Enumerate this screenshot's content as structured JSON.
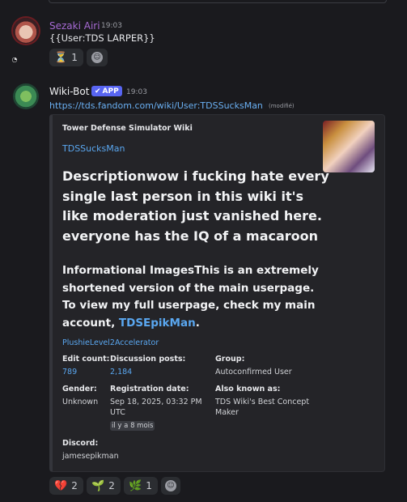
{
  "message1": {
    "username": "Sezaki Airi",
    "username_color": "#a66ad3",
    "time": "19:03",
    "text": "{{User:TDS LARPER}}",
    "reactions": [
      {
        "icon": "hourglass-icon",
        "emoji": "⏳",
        "count": "1"
      }
    ]
  },
  "message2": {
    "username": "Wiki-Bot",
    "badge": "APP",
    "time": "19:03",
    "link": "https://tds.fandom.com/wiki/User:TDSSucksMan",
    "modified": "(modifié)",
    "embed": {
      "provider": "Tower Defense Simulator Wiki",
      "title": "TDSSucksMan",
      "description": "Descriptionwow i fucking hate every single last person in this wiki it's like moderation just vanished here. everyone has the IQ of a macaroon",
      "info_text": "Informational ImagesThis is an extremely shortened version of the main userpage. To view my full userpage, check my main account,",
      "info_link": "TDSEpikMan",
      "info_end": ".",
      "plushie": "PlushieLevel2Accelerator",
      "fields": {
        "edit_count": {
          "name": "Edit count:",
          "value": "789"
        },
        "discussion_posts": {
          "name": "Discussion posts:",
          "value": "2,184"
        },
        "group": {
          "name": "Group:",
          "value": "Autoconfirmed User"
        },
        "gender": {
          "name": "Gender:",
          "value": "Unknown"
        },
        "registration": {
          "name": "Registration date:",
          "value": "Sep 18, 2025, 03:32 PM UTC",
          "relative": "il y a 8 mois"
        },
        "also_known": {
          "name": "Also known as:",
          "value": "TDS Wiki's Best Concept Maker"
        },
        "discord": {
          "name": "Discord:",
          "value": "jamesepikman"
        }
      }
    },
    "reactions": [
      {
        "icon": "broken-heart-icon",
        "emoji": "💔",
        "count": "2"
      },
      {
        "icon": "sprout-icon",
        "emoji": "🌱",
        "count": "2"
      },
      {
        "icon": "herb-icon",
        "emoji": "🌿",
        "count": "1"
      }
    ]
  },
  "colors": {
    "link": "#5aa7f0",
    "app_badge": "#5865f2"
  }
}
